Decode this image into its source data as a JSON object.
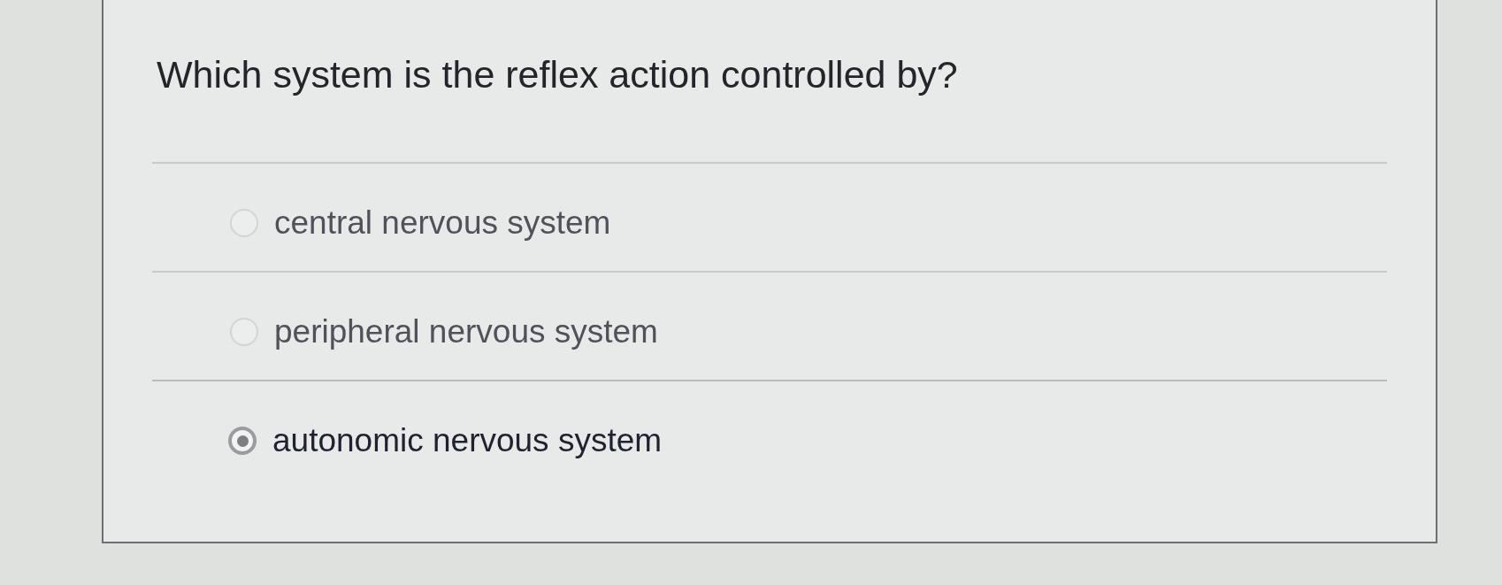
{
  "question": {
    "text": "Which system is the reflex action controlled by?"
  },
  "options": [
    {
      "label": "central nervous system",
      "selected": false
    },
    {
      "label": "peripheral nervous system",
      "selected": false
    },
    {
      "label": "autonomic nervous system",
      "selected": true
    }
  ]
}
